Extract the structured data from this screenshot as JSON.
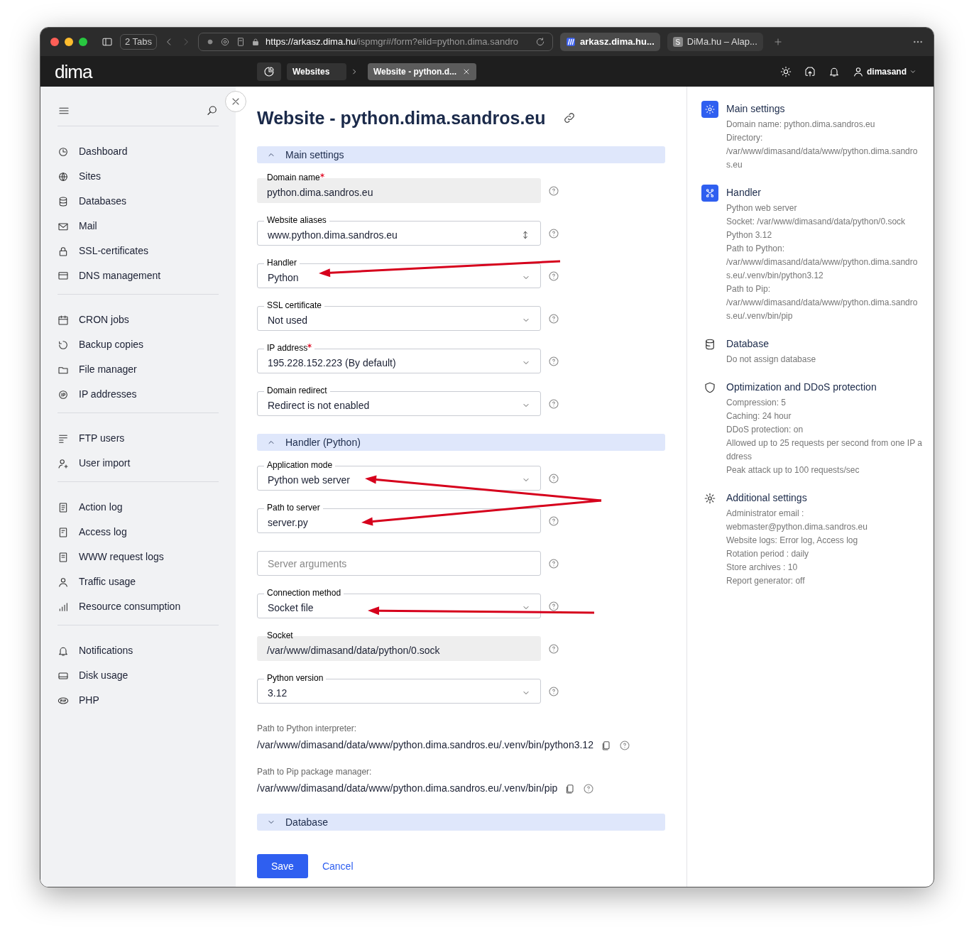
{
  "browser": {
    "tabs_count": "2 Tabs",
    "url_host": "https://arkasz.dima.hu",
    "url_path": "/ispmgr#/form?elid=python.dima.sandro",
    "tabs": [
      {
        "label": "arkasz.dima.hu...",
        "selected": true
      },
      {
        "label": "DiMa.hu – Alap...",
        "favicon": "S",
        "selected": false
      }
    ]
  },
  "header": {
    "logo": "dima",
    "breadcrumbs": [
      {
        "label": "Websites",
        "selected": false
      },
      {
        "label": "Website - python.d...",
        "selected": true
      }
    ],
    "user": "dimasand"
  },
  "sidebar": {
    "groups": [
      [
        "Dashboard",
        "Sites",
        "Databases",
        "Mail",
        "SSL-certificates",
        "DNS management"
      ],
      [
        "CRON jobs",
        "Backup copies",
        "File manager",
        "IP addresses"
      ],
      [
        "FTP users",
        "User import"
      ],
      [
        "Action log",
        "Access log",
        "WWW request logs",
        "Traffic usage",
        "Resource consumption"
      ],
      [
        "Notifications",
        "Disk usage",
        "PHP"
      ]
    ]
  },
  "form": {
    "title": "Website - python.dima.sandros.eu",
    "sections": [
      {
        "title": "Main settings",
        "expanded": true,
        "fields": [
          {
            "kind": "readonly",
            "label": "Domain name",
            "required": true,
            "value": "python.dima.sandros.eu"
          },
          {
            "kind": "aliases",
            "label": "Website aliases",
            "required": false,
            "value": "www.python.dima.sandros.eu"
          },
          {
            "kind": "select",
            "label": "Handler",
            "required": false,
            "value": "Python"
          },
          {
            "kind": "select",
            "label": "SSL certificate",
            "required": false,
            "value": "Not used"
          },
          {
            "kind": "select",
            "label": "IP address",
            "required": true,
            "value": "195.228.152.223 (By default)"
          },
          {
            "kind": "select",
            "label": "Domain redirect",
            "required": false,
            "value": "Redirect is not enabled"
          }
        ]
      },
      {
        "title": "Handler (Python)",
        "expanded": true,
        "fields": [
          {
            "kind": "select",
            "label": "Application mode",
            "required": false,
            "value": "Python web server"
          },
          {
            "kind": "text",
            "label": "Path to server",
            "required": false,
            "value": "server.py"
          },
          {
            "kind": "empty",
            "placeholder": "Server arguments"
          },
          {
            "kind": "select",
            "label": "Connection method",
            "required": false,
            "value": "Socket file"
          },
          {
            "kind": "readonly",
            "label": "Socket",
            "required": false,
            "value": "/var/www/dimasand/data/python/0.sock"
          },
          {
            "kind": "select",
            "label": "Python version",
            "required": false,
            "value": "3.12"
          }
        ],
        "paths": [
          {
            "label": "Path to Python interpreter:",
            "value": "/var/www/dimasand/data/www/python.dima.sandros.eu/.venv/bin/python3.12"
          },
          {
            "label": "Path to Pip package manager:",
            "value": "/var/www/dimasand/data/www/python.dima.sandros.eu/.venv/bin/pip"
          }
        ]
      },
      {
        "title": "Database",
        "expanded": false
      }
    ],
    "buttons": {
      "save": "Save",
      "cancel": "Cancel"
    }
  },
  "summary": [
    {
      "title": "Main settings",
      "lines": [
        "Domain name: python.dima.sandros.eu",
        "Directory:",
        "/var/www/dimasand/data/www/python.dima.sandros.eu"
      ]
    },
    {
      "title": "Handler",
      "lines": [
        "Python web server",
        "Socket: /var/www/dimasand/data/python/0.sock",
        "Python 3.12",
        "Path to Python:",
        "/var/www/dimasand/data/www/python.dima.sandros.eu/.venv/bin/python3.12",
        "Path to Pip:",
        "/var/www/dimasand/data/www/python.dima.sandros.eu/.venv/bin/pip"
      ]
    },
    {
      "title": "Database",
      "lines": [
        "Do not assign database"
      ]
    },
    {
      "title": "Optimization and DDoS protection",
      "lines": [
        "Compression: 5",
        "Caching: 24 hour",
        "DDoS protection: on",
        "Allowed up to 25 requests per second from one IP address",
        "Peak attack up to 100 requests/sec"
      ]
    },
    {
      "title": "Additional settings",
      "lines": [
        "Administrator email :",
        "webmaster@python.dima.sandros.eu",
        "Website logs: Error log, Access log",
        "Rotation period : daily",
        "Store archives : 10",
        "Report generator: off"
      ]
    }
  ]
}
